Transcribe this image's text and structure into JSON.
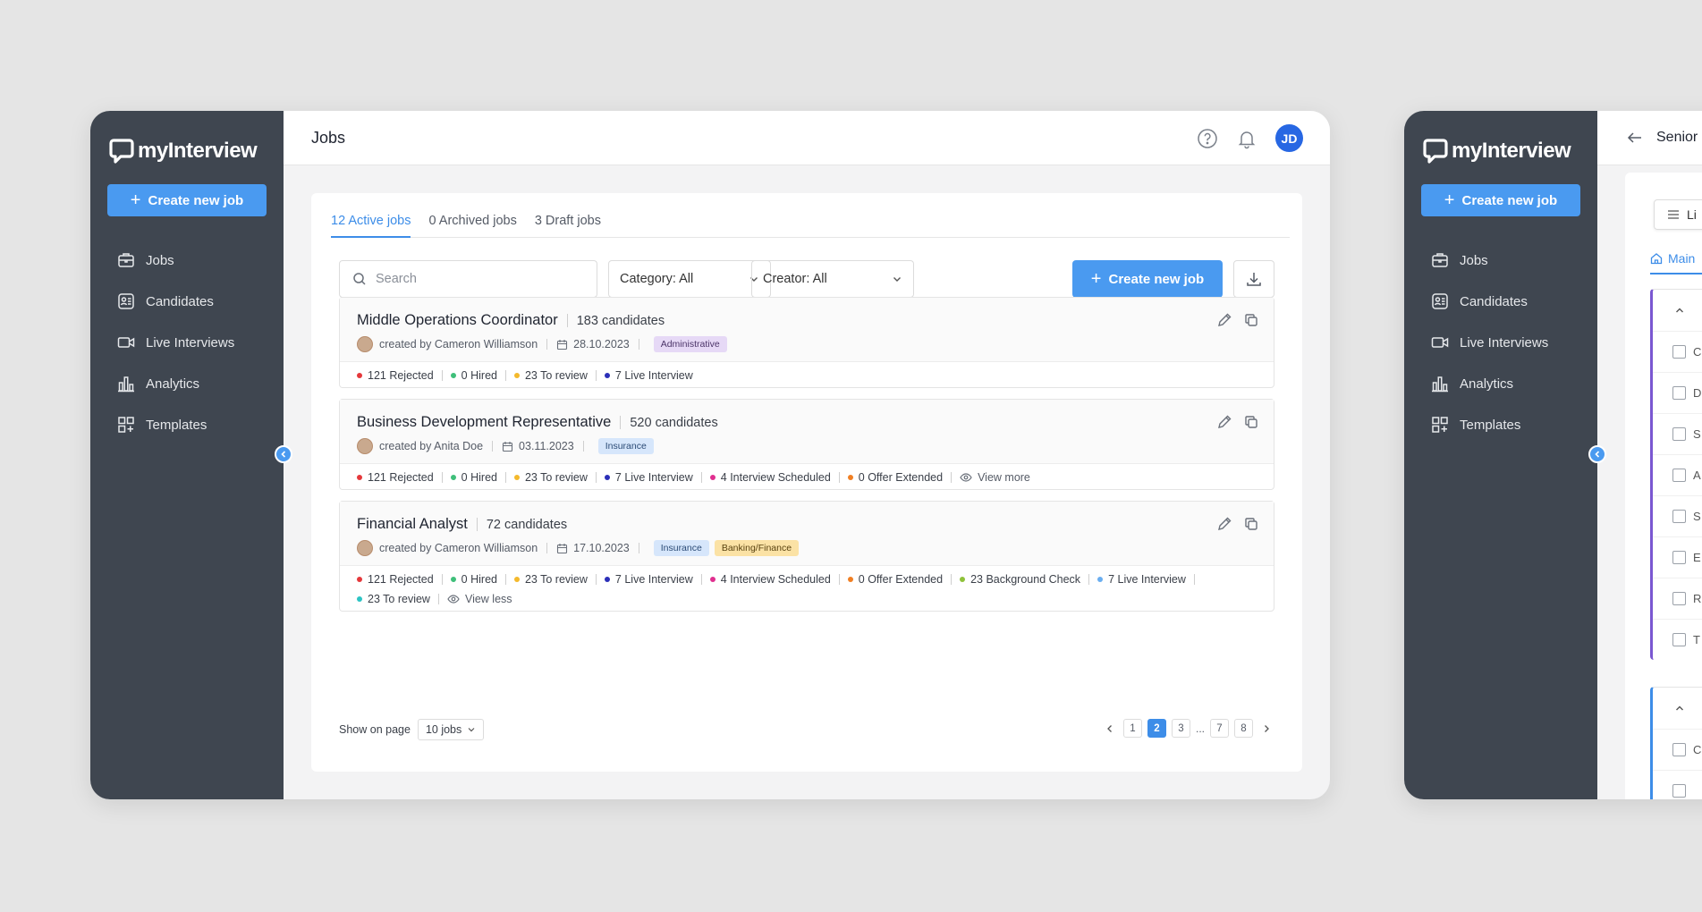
{
  "app": {
    "logo": "myInterview",
    "create_label": "Create new job",
    "nav": [
      {
        "label": "Jobs",
        "icon": "briefcase-icon"
      },
      {
        "label": "Candidates",
        "icon": "candidates-icon"
      },
      {
        "label": "Live Interviews",
        "icon": "video-icon"
      },
      {
        "label": "Analytics",
        "icon": "analytics-icon"
      },
      {
        "label": "Templates",
        "icon": "templates-icon"
      }
    ]
  },
  "header": {
    "title": "Jobs",
    "avatar_initials": "JD"
  },
  "tabs": [
    {
      "label": "12 Active jobs",
      "active": true
    },
    {
      "label": "0 Archived jobs",
      "active": false
    },
    {
      "label": "3 Draft jobs",
      "active": false
    }
  ],
  "filters": {
    "search_placeholder": "Search",
    "category": "Category: All",
    "creator": "Creator: All",
    "create_label": "Create new job"
  },
  "jobs": [
    {
      "title": "Middle Operations Coordinator",
      "count": "183",
      "candidates_word": "candidates",
      "creator": "created by Cameron Williamson",
      "date": "28.10.2023",
      "tags": [
        {
          "label": "Administrative",
          "color": "purple"
        }
      ],
      "stats": [
        {
          "label": "121 Rejected",
          "color": "#e5383b"
        },
        {
          "label": "0 Hired",
          "color": "#3fbf7a"
        },
        {
          "label": "23 To review",
          "color": "#f4b92c"
        },
        {
          "label": "7 Live Interview",
          "color": "#2b2fb8"
        }
      ]
    },
    {
      "title": "Business Development Representative",
      "count": "520",
      "candidates_word": "candidates",
      "creator": "created by Anita Doe",
      "date": "03.11.2023",
      "tags": [
        {
          "label": "Insurance",
          "color": "blue"
        }
      ],
      "stats": [
        {
          "label": "121 Rejected",
          "color": "#e5383b"
        },
        {
          "label": "0 Hired",
          "color": "#3fbf7a"
        },
        {
          "label": "23 To review",
          "color": "#f4b92c"
        },
        {
          "label": "7 Live Interview",
          "color": "#2b2fb8"
        },
        {
          "label": "4 Interview Scheduled",
          "color": "#e02f8f"
        },
        {
          "label": "0 Offer Extended",
          "color": "#f07f23"
        }
      ],
      "toggle": "View more"
    },
    {
      "title": "Financial Analyst",
      "count": "72",
      "candidates_word": "candidates",
      "creator": "created by Cameron Williamson",
      "date": "17.10.2023",
      "tags": [
        {
          "label": "Insurance",
          "color": "blue"
        },
        {
          "label": "Banking/Finance",
          "color": "yellow"
        }
      ],
      "stats": [
        {
          "label": "121 Rejected",
          "color": "#e5383b"
        },
        {
          "label": "0 Hired",
          "color": "#3fbf7a"
        },
        {
          "label": "23 To review",
          "color": "#f4b92c"
        },
        {
          "label": "7 Live Interview",
          "color": "#2b2fb8"
        },
        {
          "label": "4 Interview Scheduled",
          "color": "#e02f8f"
        },
        {
          "label": "0 Offer Extended",
          "color": "#f07f23"
        },
        {
          "label": "23 Background Check",
          "color": "#8fc23a"
        },
        {
          "label": "7 Live Interview",
          "color": "#6aaef0"
        },
        {
          "label": "23 To review",
          "color": "#2cc4c4"
        }
      ],
      "toggle": "View less"
    }
  ],
  "footer": {
    "show_label": "Show on page",
    "per_page": "10 jobs",
    "pages": [
      "1",
      "2",
      "3",
      "...",
      "7",
      "8"
    ],
    "current_page": "2"
  },
  "second_window": {
    "title": "Senior",
    "list_label": "Li",
    "main_tab": "Main",
    "row_initials": [
      "C",
      "D",
      "S",
      "A",
      "S",
      "E",
      "R",
      "T"
    ],
    "row_initials_2": [
      "C"
    ]
  }
}
